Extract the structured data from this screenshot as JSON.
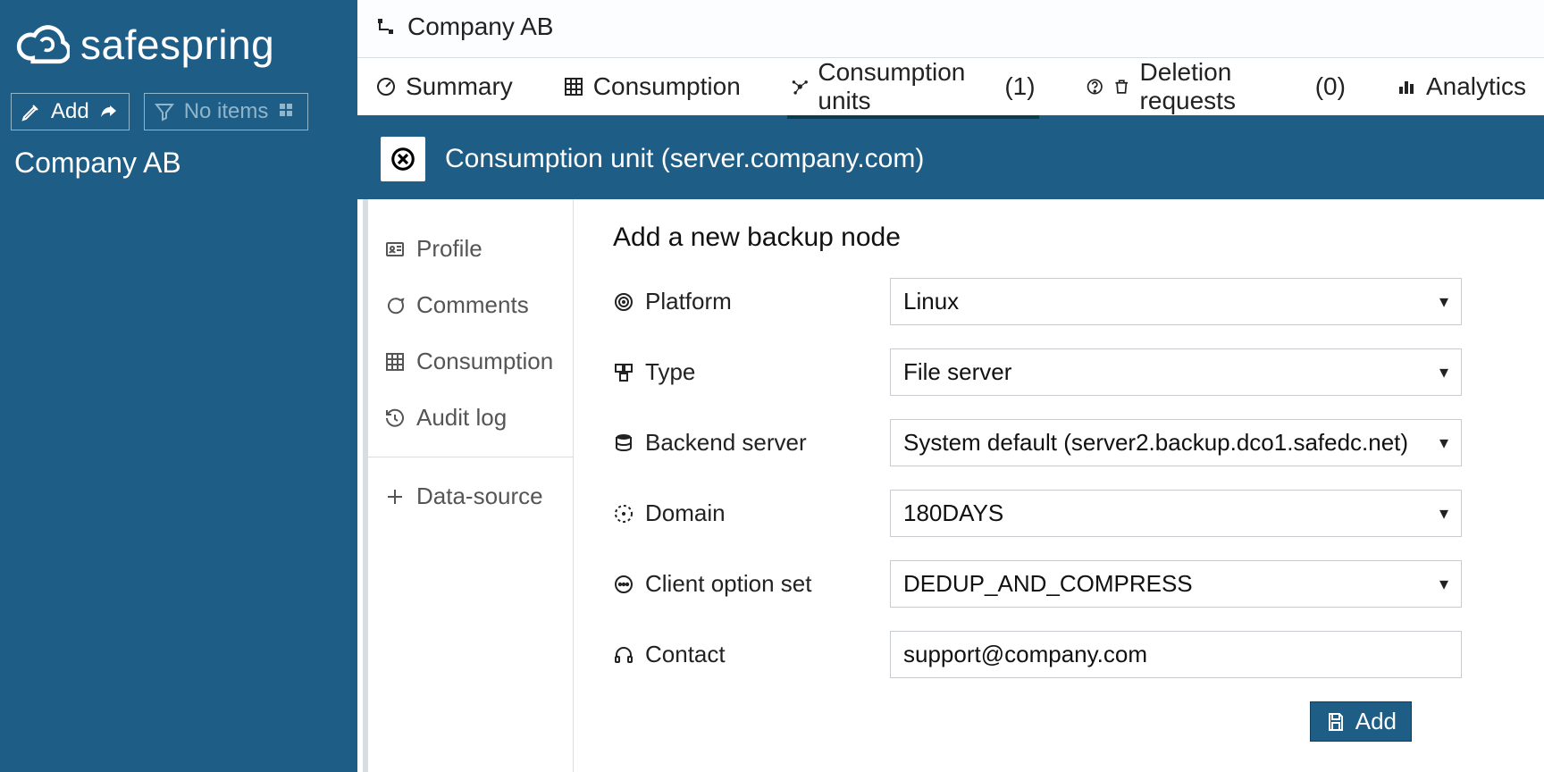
{
  "brand": {
    "name": "safespring"
  },
  "sidebar": {
    "add_label": "Add",
    "filter_label": "No items",
    "company": "Company AB"
  },
  "breadcrumb": {
    "company": "Company AB"
  },
  "tabs": {
    "summary": "Summary",
    "consumption": "Consumption",
    "units": "Consumption units",
    "units_count": "(1)",
    "deletion": "Deletion requests",
    "deletion_count": "(0)",
    "analytics": "Analytics"
  },
  "unit_header": {
    "title": "Consumption unit (server.company.com)"
  },
  "subnav": {
    "profile": "Profile",
    "comments": "Comments",
    "consumption": "Consumption",
    "audit": "Audit log",
    "datasource": "Data-source"
  },
  "form": {
    "title": "Add a new backup node",
    "labels": {
      "platform": "Platform",
      "type": "Type",
      "backend": "Backend server",
      "domain": "Domain",
      "optionset": "Client option set",
      "contact": "Contact"
    },
    "values": {
      "platform": "Linux",
      "type": "File server",
      "backend": "System default (server2.backup.dco1.safedc.net)",
      "domain": "180DAYS",
      "optionset": "DEDUP_AND_COMPRESS",
      "contact": "support@company.com"
    },
    "add_button": "Add"
  }
}
